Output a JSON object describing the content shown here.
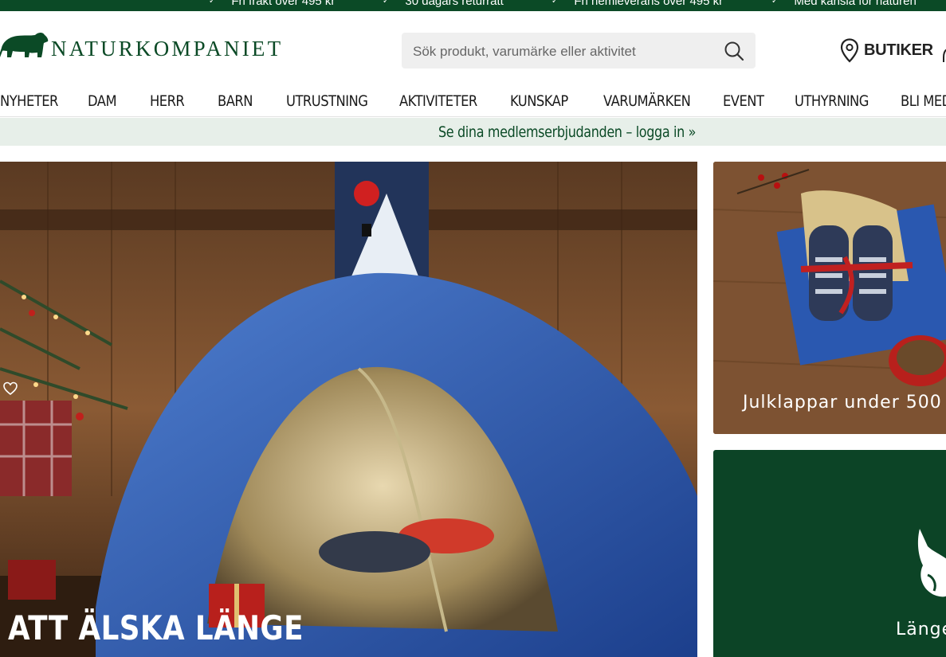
{
  "promo": {
    "items": [
      "Fri frakt över 495 kr",
      "30 dagars returrätt",
      "Fri hemleverans över 495 kr",
      "Med känsla för naturen"
    ]
  },
  "header": {
    "logo_text": "NATURKOMPANIET",
    "logo_icon": "bear-icon",
    "search_placeholder": "Sök produkt, varumärke eller aktivitet",
    "stores_label": "BUTIKER"
  },
  "nav": {
    "items": [
      "NYHETER",
      "DAM",
      "HERR",
      "BARN",
      "UTRUSTNING",
      "AKTIVITETER",
      "KUNSKAP",
      "VARUMÄRKEN",
      "EVENT",
      "UTHYRNING",
      "BLI MED"
    ]
  },
  "member_bar": {
    "text": "Se dina medlemserbjudanden – logga in »"
  },
  "hero": {
    "title": "ATT ÄLSKA LÄNGE"
  },
  "cards": {
    "gifts_label": "Julklappar under 500",
    "brand_label": "Länge"
  },
  "colors": {
    "brand_green": "#0b4a26",
    "member_bar_bg": "#e7efe9",
    "search_bg": "#efefef"
  }
}
